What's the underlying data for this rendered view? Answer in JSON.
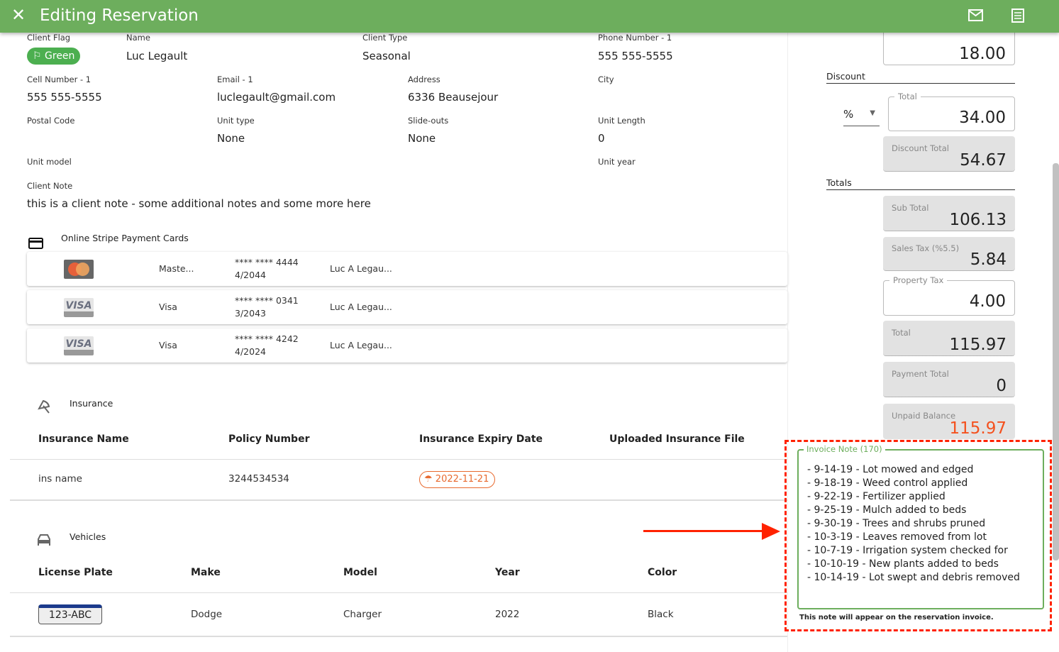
{
  "header": {
    "title": "Editing Reservation",
    "close_icon": "close-icon",
    "mail_icon": "mail-icon",
    "document_icon": "document-icon"
  },
  "client": {
    "flag_label": "Client Flag",
    "flag_value": "Green",
    "flag_color": "#4CAF50",
    "name_label": "Name",
    "name": "Luc Legault",
    "type_label": "Client Type",
    "type": "Seasonal",
    "phone_label": "Phone Number - 1",
    "phone": "555 555-5555",
    "cell_label": "Cell Number - 1",
    "cell": "555 555-5555",
    "email_label": "Email - 1",
    "email": "luclegault@gmail.com",
    "address_label": "Address",
    "address": "6336 Beausejour",
    "city_label": "City",
    "postal_label": "Postal Code",
    "unit_type_label": "Unit type",
    "unit_type": "None",
    "slideouts_label": "Slide-outs",
    "slideouts": "None",
    "unit_length_label": "Unit Length",
    "unit_length": "0",
    "unit_model_label": "Unit model",
    "unit_year_label": "Unit year",
    "note_label": "Client Note",
    "note": "this is a client note - some additional notes and some more here"
  },
  "cards": {
    "title": "Online Stripe Payment Cards",
    "items": [
      {
        "brand": "Maste...",
        "number": "**** **** 4444",
        "exp": "4/2044",
        "holder": "Luc A Legau...",
        "logo": "mastercard"
      },
      {
        "brand": "Visa",
        "number": "**** **** 0341",
        "exp": "3/2043",
        "holder": "Luc A Legau...",
        "logo": "visa",
        "logo_text": "VISA"
      },
      {
        "brand": "Visa",
        "number": "**** **** 4242",
        "exp": "4/2024",
        "holder": "Luc A Legau...",
        "logo": "visa",
        "logo_text": "VISA"
      }
    ]
  },
  "insurance": {
    "title": "Insurance",
    "headers": [
      "Insurance Name",
      "Policy Number",
      "Insurance Expiry Date",
      "Uploaded Insurance File"
    ],
    "rows": [
      {
        "name": "ins name",
        "policy": "3244534534",
        "expiry": "2022-11-21"
      }
    ],
    "expiry_color": "#E8692E"
  },
  "vehicles": {
    "title": "Vehicles",
    "headers": [
      "License Plate",
      "Make",
      "Model",
      "Year",
      "Color"
    ],
    "rows": [
      {
        "plate": "123-ABC",
        "make": "Dodge",
        "model": "Charger",
        "year": "2022",
        "color": "Black"
      }
    ]
  },
  "totals": {
    "top_value": "18.00",
    "discount_label": "Discount",
    "discount_type": "%",
    "discount_total_label": "Total",
    "discount_total": "34.00",
    "discount_amount_label": "Discount Total",
    "discount_amount": "54.67",
    "totals_label": "Totals",
    "sub_total_label": "Sub Total",
    "sub_total": "106.13",
    "sales_tax_label": "Sales Tax (%5.5)",
    "sales_tax": "5.84",
    "property_tax_label": "Property Tax",
    "property_tax": "4.00",
    "total_label": "Total",
    "total": "115.97",
    "payment_total_label": "Payment Total",
    "payment_total": "0",
    "unpaid_label": "Unpaid Balance",
    "unpaid": "115.97",
    "unpaid_color": "#F4511E"
  },
  "invoice_note": {
    "label": "Invoice Note (170)",
    "lines": [
      "- 9-14-19 - Lot mowed and edged",
      "- 9-18-19 - Weed control applied",
      "- 9-22-19 - Fertilizer applied",
      "- 9-25-19 - Mulch added to beds",
      "- 9-30-19 - Trees and shrubs pruned",
      "- 10-3-19 - Leaves removed from lot",
      "- 10-7-19 - Irrigation system checked for",
      "- 10-10-19 - New plants added to beds",
      "- 10-14-19 - Lot swept and debris removed"
    ],
    "hint": "This note will appear on the reservation invoice.",
    "accent": "#6DAE5D"
  },
  "annotation": {
    "color": "#FF2200"
  }
}
